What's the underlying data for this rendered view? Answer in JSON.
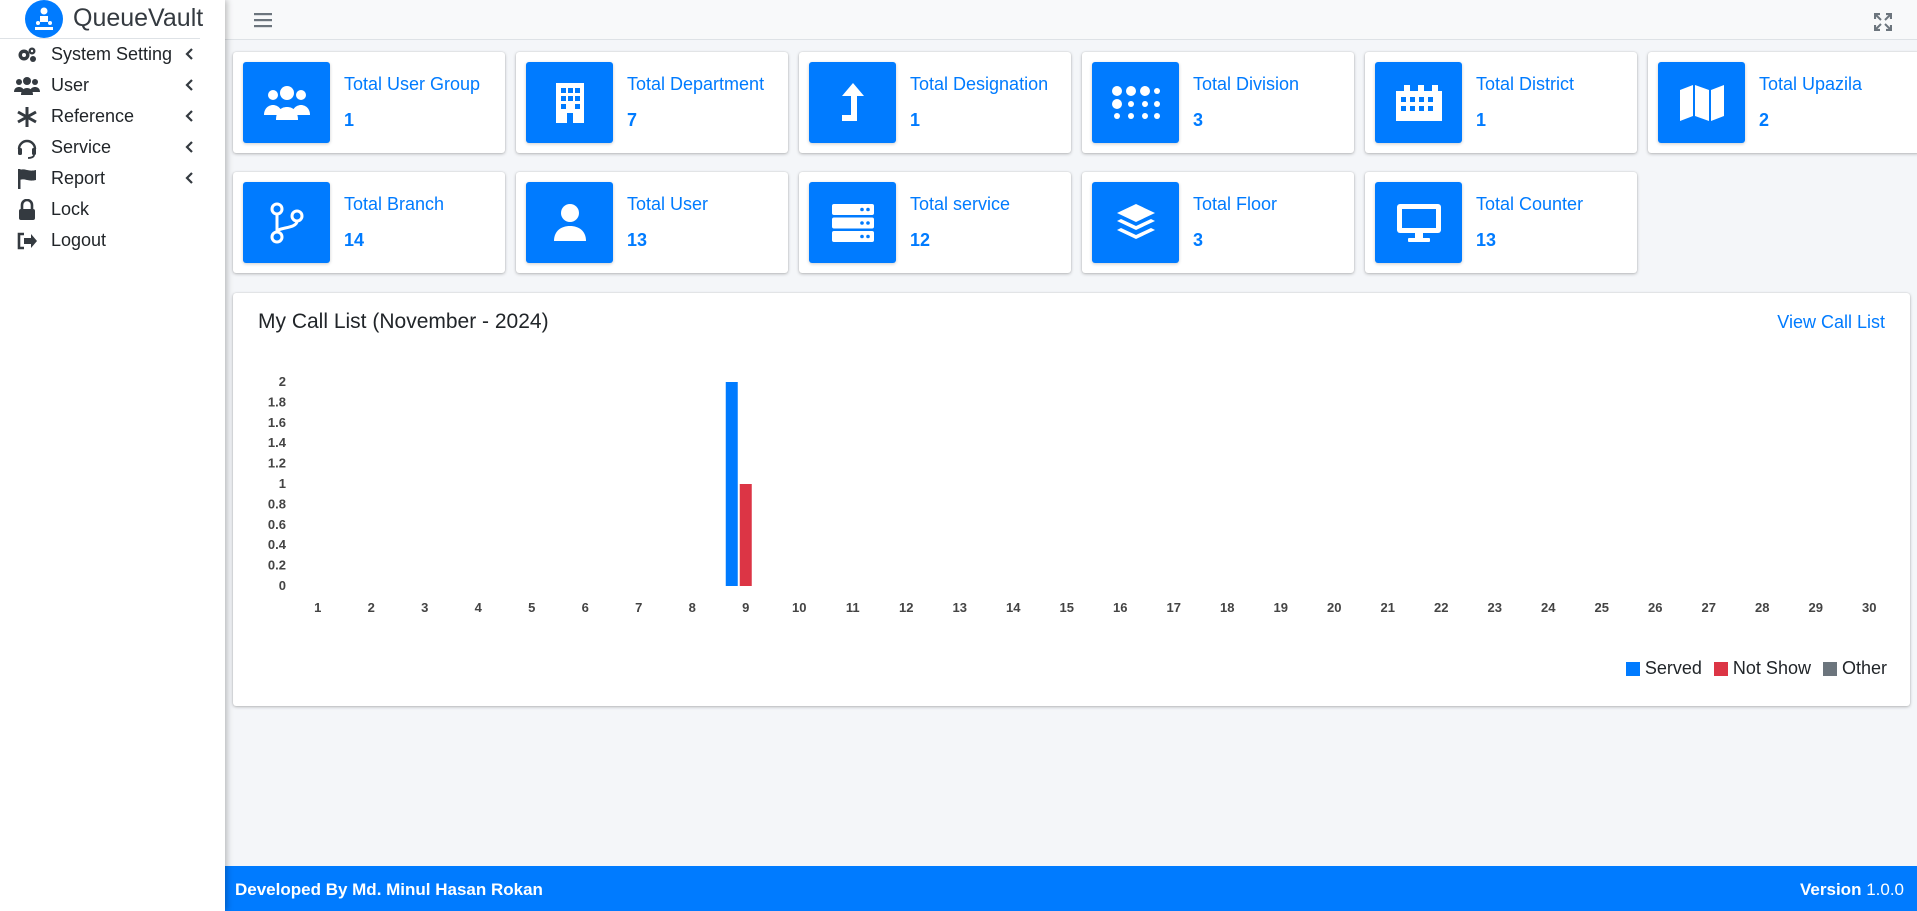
{
  "brand": {
    "name": "QueueVault"
  },
  "sidebar": {
    "items": [
      {
        "label": "System Setting",
        "icon": "gears-icon",
        "has_submenu": true
      },
      {
        "label": "User",
        "icon": "users-icon",
        "has_submenu": true
      },
      {
        "label": "Reference",
        "icon": "asterisk-icon",
        "has_submenu": true
      },
      {
        "label": "Service",
        "icon": "headset-icon",
        "has_submenu": true
      },
      {
        "label": "Report",
        "icon": "flag-icon",
        "has_submenu": true
      },
      {
        "label": "Lock",
        "icon": "lock-icon",
        "has_submenu": false
      },
      {
        "label": "Logout",
        "icon": "logout-icon",
        "has_submenu": false
      }
    ]
  },
  "cards": [
    {
      "title": "Total User Group",
      "value": "1",
      "icon": "users-group-icon"
    },
    {
      "title": "Total Department",
      "value": "7",
      "icon": "building-icon"
    },
    {
      "title": "Total Designation",
      "value": "1",
      "icon": "level-up-icon"
    },
    {
      "title": "Total Division",
      "value": "3",
      "icon": "braille-icon"
    },
    {
      "title": "Total District",
      "value": "1",
      "icon": "industry-icon"
    },
    {
      "title": "Total Upazila",
      "value": "2",
      "icon": "map-icon"
    },
    {
      "title": "Total Branch",
      "value": "14",
      "icon": "branch-icon"
    },
    {
      "title": "Total User",
      "value": "13",
      "icon": "user-icon"
    },
    {
      "title": "Total service",
      "value": "12",
      "icon": "server-icon"
    },
    {
      "title": "Total Floor",
      "value": "3",
      "icon": "layers-icon"
    },
    {
      "title": "Total Counter",
      "value": "13",
      "icon": "desktop-icon"
    }
  ],
  "call_list": {
    "title": "My Call List (November - 2024)",
    "link": "View Call List"
  },
  "colors": {
    "primary": "#007bff",
    "served": "#007bff",
    "not_show": "#dc3545",
    "other": "#6c757d"
  },
  "chart_data": {
    "type": "bar",
    "categories": [
      "1",
      "2",
      "3",
      "4",
      "5",
      "6",
      "7",
      "8",
      "9",
      "10",
      "11",
      "12",
      "13",
      "14",
      "15",
      "16",
      "17",
      "18",
      "19",
      "20",
      "21",
      "22",
      "23",
      "24",
      "25",
      "26",
      "27",
      "28",
      "29",
      "30"
    ],
    "series": [
      {
        "name": "Served",
        "color": "#007bff",
        "values": [
          0,
          0,
          0,
          0,
          0,
          0,
          0,
          0,
          2,
          0,
          0,
          0,
          0,
          0,
          0,
          0,
          0,
          0,
          0,
          0,
          0,
          0,
          0,
          0,
          0,
          0,
          0,
          0,
          0,
          0
        ]
      },
      {
        "name": "Not Show",
        "color": "#dc3545",
        "values": [
          0,
          0,
          0,
          0,
          0,
          0,
          0,
          0,
          1,
          0,
          0,
          0,
          0,
          0,
          0,
          0,
          0,
          0,
          0,
          0,
          0,
          0,
          0,
          0,
          0,
          0,
          0,
          0,
          0,
          0
        ]
      },
      {
        "name": "Other",
        "color": "#6c757d",
        "values": [
          0,
          0,
          0,
          0,
          0,
          0,
          0,
          0,
          0,
          0,
          0,
          0,
          0,
          0,
          0,
          0,
          0,
          0,
          0,
          0,
          0,
          0,
          0,
          0,
          0,
          0,
          0,
          0,
          0,
          0
        ]
      }
    ],
    "yticks": [
      "0",
      "0.2",
      "0.4",
      "0.6",
      "0.8",
      "1",
      "1.2",
      "1.4",
      "1.6",
      "1.8",
      "2"
    ],
    "ylim": [
      0,
      2
    ],
    "legend": "bottom-right",
    "grid": false
  },
  "footer": {
    "developer": "Developed By Md. Minul Hasan Rokan",
    "version_label": "Version",
    "version": "1.0.0"
  }
}
